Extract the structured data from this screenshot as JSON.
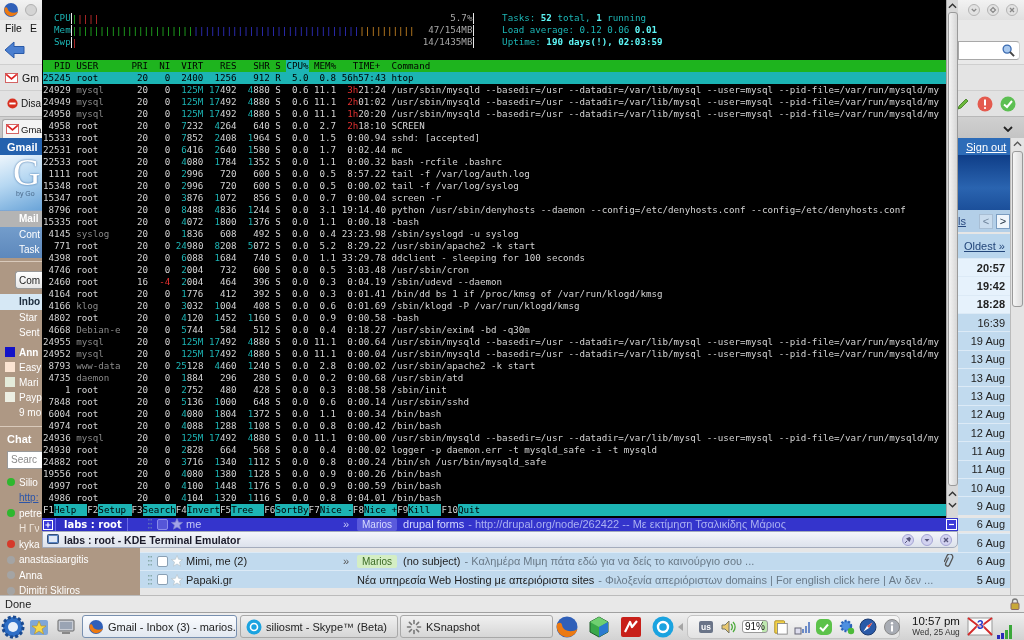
{
  "browser": {
    "menu": [
      "File",
      "E"
    ],
    "bookmarks": [
      "Gm"
    ],
    "devtools": [
      "Disa"
    ],
    "tabs": [
      {
        "label": "Gma",
        "selected": true
      }
    ],
    "status": "Done"
  },
  "terminal": {
    "meters": [
      {
        "label": "CPU",
        "reading": "5.7%",
        "segments": [
          {
            "kind": "user",
            "bars": "|"
          },
          {
            "kind": "system",
            "bars": "||||"
          }
        ]
      },
      {
        "label": "Mem",
        "reading": "47/154MB",
        "segments": [
          {
            "kind": "used",
            "bars": "||||||||||||||||||||||"
          },
          {
            "kind": "buffers",
            "bars": "||||||||||||||||||||||||||||||"
          },
          {
            "kind": "cache",
            "bars": "||||||||||"
          }
        ]
      },
      {
        "label": "Swp",
        "reading": "14/1435MB",
        "segments": [
          {
            "kind": "swap",
            "bars": "|"
          }
        ]
      }
    ],
    "summary": {
      "tasks": "Tasks: **52** total, **1** running",
      "load": "Load average: 0.12 0.06 **0.01**",
      "uptime": "Uptime: **190 days(!), 02:03:59**"
    },
    "columns": [
      {
        "label": "PID",
        "kind": "pid",
        "selected": false
      },
      {
        "label": "USER",
        "kind": "user",
        "selected": false
      },
      {
        "label": "PRI",
        "kind": "priority",
        "selected": false
      },
      {
        "label": "NI",
        "kind": "nice",
        "selected": false
      },
      {
        "label": "VIRT",
        "kind": "memory",
        "selected": false
      },
      {
        "label": "RES",
        "kind": "memory",
        "selected": false
      },
      {
        "label": "SHR",
        "kind": "memory",
        "selected": false
      },
      {
        "label": "S",
        "kind": "state",
        "selected": false
      },
      {
        "label": "CPU%",
        "kind": "percent",
        "selected": true
      },
      {
        "label": "MEM%",
        "kind": "percent",
        "selected": false
      },
      {
        "label": "TIME+",
        "kind": "time",
        "selected": false
      },
      {
        "label": "Command",
        "kind": "command",
        "selected": false
      }
    ],
    "processes": [
      {
        "cells": [
          "25245",
          "root",
          "20",
          "0",
          "2400",
          "1256",
          "912",
          "R",
          "5.0",
          "0.8",
          "56h57:43",
          "htop"
        ],
        "other_user": false,
        "selected": true
      },
      {
        "cells": [
          "24929",
          "mysql",
          "20",
          "0",
          "125M",
          "17492",
          "4880",
          "S",
          "0.6",
          "11.1",
          "3h21:24",
          "/usr/sbin/mysqld --basedir=/usr --datadir=/var/lib/mysql --user=mysql --pid-file=/var/run/mysqld/my"
        ],
        "other_user": true,
        "selected": false
      },
      {
        "cells": [
          "24949",
          "mysql",
          "20",
          "0",
          "125M",
          "17492",
          "4880",
          "S",
          "0.6",
          "11.1",
          "2h01:02",
          "/usr/sbin/mysqld --basedir=/usr --datadir=/var/lib/mysql --user=mysql --pid-file=/var/run/mysqld/my"
        ],
        "other_user": true,
        "selected": false
      },
      {
        "cells": [
          "24950",
          "mysql",
          "20",
          "0",
          "125M",
          "17492",
          "4880",
          "S",
          "0.0",
          "11.1",
          "1h20:20",
          "/usr/sbin/mysqld --basedir=/usr --datadir=/var/lib/mysql --user=mysql --pid-file=/var/run/mysqld/my"
        ],
        "other_user": true,
        "selected": false
      },
      {
        "cells": [
          "4958",
          "root",
          "20",
          "0",
          "7232",
          "4264",
          "640",
          "S",
          "0.0",
          "2.7",
          "2h18:10",
          "SCREEN"
        ],
        "other_user": false,
        "selected": false
      },
      {
        "cells": [
          "15333",
          "root",
          "20",
          "0",
          "7852",
          "2408",
          "1964",
          "S",
          "0.0",
          "1.5",
          "0:00.94",
          "sshd: [accepted]"
        ],
        "other_user": false,
        "selected": false
      },
      {
        "cells": [
          "22531",
          "root",
          "20",
          "0",
          "6416",
          "2640",
          "1580",
          "S",
          "0.0",
          "1.7",
          "0:02.44",
          "mc"
        ],
        "other_user": false,
        "selected": false
      },
      {
        "cells": [
          "22533",
          "root",
          "20",
          "0",
          "4080",
          "1784",
          "1352",
          "S",
          "0.0",
          "1.1",
          "0:00.32",
          "bash -rcfile .bashrc"
        ],
        "other_user": false,
        "selected": false
      },
      {
        "cells": [
          "1111",
          "root",
          "20",
          "0",
          "2996",
          "720",
          "600",
          "S",
          "0.0",
          "0.5",
          "8:57.22",
          "tail -f /var/log/auth.log"
        ],
        "other_user": false,
        "selected": false
      },
      {
        "cells": [
          "15348",
          "root",
          "20",
          "0",
          "2996",
          "720",
          "600",
          "S",
          "0.0",
          "0.5",
          "0:00.02",
          "tail -f /var/log/syslog"
        ],
        "other_user": false,
        "selected": false
      },
      {
        "cells": [
          "15347",
          "root",
          "20",
          "0",
          "3876",
          "1072",
          "856",
          "S",
          "0.0",
          "0.7",
          "0:00.04",
          "screen -r"
        ],
        "other_user": false,
        "selected": false
      },
      {
        "cells": [
          "8796",
          "root",
          "20",
          "0",
          "8488",
          "4836",
          "1244",
          "S",
          "0.0",
          "3.1",
          "19:14.40",
          "python /usr/sbin/denyhosts --daemon --config=/etc/denyhosts.conf --config=/etc/denyhosts.conf"
        ],
        "other_user": false,
        "selected": false
      },
      {
        "cells": [
          "15335",
          "root",
          "20",
          "0",
          "4072",
          "1800",
          "1376",
          "S",
          "0.0",
          "1.1",
          "0:00.18",
          "-bash"
        ],
        "other_user": false,
        "selected": false
      },
      {
        "cells": [
          "4145",
          "syslog",
          "20",
          "0",
          "1836",
          "608",
          "492",
          "S",
          "0.0",
          "0.4",
          "23:23.98",
          "/sbin/syslogd -u syslog"
        ],
        "other_user": true,
        "selected": false
      },
      {
        "cells": [
          "771",
          "root",
          "20",
          "0",
          "24980",
          "8208",
          "5072",
          "S",
          "0.0",
          "5.2",
          "8:29.22",
          "/usr/sbin/apache2 -k start"
        ],
        "other_user": false,
        "selected": false
      },
      {
        "cells": [
          "4398",
          "root",
          "20",
          "0",
          "6088",
          "1684",
          "740",
          "S",
          "0.0",
          "1.1",
          "33:29.78",
          "ddclient - sleeping for 100 seconds"
        ],
        "other_user": false,
        "selected": false
      },
      {
        "cells": [
          "4746",
          "root",
          "20",
          "0",
          "2004",
          "732",
          "600",
          "S",
          "0.0",
          "0.5",
          "3:03.48",
          "/usr/sbin/cron"
        ],
        "other_user": false,
        "selected": false
      },
      {
        "cells": [
          "2460",
          "root",
          "16",
          "-4",
          "2004",
          "464",
          "396",
          "S",
          "0.0",
          "0.3",
          "0:04.19",
          "/sbin/udevd --daemon"
        ],
        "other_user": false,
        "selected": false
      },
      {
        "cells": [
          "4164",
          "root",
          "20",
          "0",
          "1776",
          "412",
          "392",
          "S",
          "0.0",
          "0.3",
          "0:01.41",
          "/bin/dd bs 1 if /proc/kmsg of /var/run/klogd/kmsg"
        ],
        "other_user": false,
        "selected": false
      },
      {
        "cells": [
          "4166",
          "klog",
          "20",
          "0",
          "3032",
          "1004",
          "408",
          "S",
          "0.0",
          "0.6",
          "0:01.69",
          "/sbin/klogd -P /var/run/klogd/kmsg"
        ],
        "other_user": true,
        "selected": false
      },
      {
        "cells": [
          "4802",
          "root",
          "20",
          "0",
          "4120",
          "1452",
          "1160",
          "S",
          "0.0",
          "0.9",
          "0:00.58",
          "-bash"
        ],
        "other_user": false,
        "selected": false
      },
      {
        "cells": [
          "4668",
          "Debian-e",
          "20",
          "0",
          "5744",
          "584",
          "512",
          "S",
          "0.0",
          "0.4",
          "0:18.27",
          "/usr/sbin/exim4 -bd -q30m"
        ],
        "other_user": true,
        "selected": false
      },
      {
        "cells": [
          "24955",
          "mysql",
          "20",
          "0",
          "125M",
          "17492",
          "4880",
          "S",
          "0.0",
          "11.1",
          "0:00.64",
          "/usr/sbin/mysqld --basedir=/usr --datadir=/var/lib/mysql --user=mysql --pid-file=/var/run/mysqld/my"
        ],
        "other_user": true,
        "selected": false
      },
      {
        "cells": [
          "24952",
          "mysql",
          "20",
          "0",
          "125M",
          "17492",
          "4880",
          "S",
          "0.0",
          "11.1",
          "0:00.04",
          "/usr/sbin/mysqld --basedir=/usr --datadir=/var/lib/mysql --user=mysql --pid-file=/var/run/mysqld/my"
        ],
        "other_user": true,
        "selected": false
      },
      {
        "cells": [
          "8793",
          "www-data",
          "20",
          "0",
          "25128",
          "4460",
          "1240",
          "S",
          "0.0",
          "2.8",
          "0:00.02",
          "/usr/sbin/apache2 -k start"
        ],
        "other_user": true,
        "selected": false
      },
      {
        "cells": [
          "4735",
          "daemon",
          "20",
          "0",
          "1884",
          "296",
          "280",
          "S",
          "0.0",
          "0.2",
          "0:00.68",
          "/usr/sbin/atd"
        ],
        "other_user": true,
        "selected": false
      },
      {
        "cells": [
          "1",
          "root",
          "20",
          "0",
          "2752",
          "480",
          "428",
          "S",
          "0.0",
          "0.3",
          "8:08.58",
          "/sbin/init"
        ],
        "other_user": false,
        "selected": false
      },
      {
        "cells": [
          "7848",
          "root",
          "20",
          "0",
          "5136",
          "1000",
          "648",
          "S",
          "0.0",
          "0.6",
          "0:00.14",
          "/usr/sbin/sshd"
        ],
        "other_user": false,
        "selected": false
      },
      {
        "cells": [
          "6004",
          "root",
          "20",
          "0",
          "4080",
          "1804",
          "1372",
          "S",
          "0.0",
          "1.1",
          "0:00.34",
          "/bin/bash"
        ],
        "other_user": false,
        "selected": false
      },
      {
        "cells": [
          "4974",
          "root",
          "20",
          "0",
          "4088",
          "1288",
          "1108",
          "S",
          "0.0",
          "0.8",
          "0:00.42",
          "/bin/bash"
        ],
        "other_user": false,
        "selected": false
      },
      {
        "cells": [
          "24936",
          "mysql",
          "20",
          "0",
          "125M",
          "17492",
          "4880",
          "S",
          "0.0",
          "11.1",
          "0:00.00",
          "/usr/sbin/mysqld --basedir=/usr --datadir=/var/lib/mysql --user=mysql --pid-file=/var/run/mysqld/my"
        ],
        "other_user": true,
        "selected": false
      },
      {
        "cells": [
          "24930",
          "root",
          "20",
          "0",
          "2828",
          "664",
          "568",
          "S",
          "0.0",
          "0.4",
          "0:00.02",
          "logger -p daemon.err -t mysqld_safe -i -t mysqld"
        ],
        "other_user": false,
        "selected": false
      },
      {
        "cells": [
          "24882",
          "root",
          "20",
          "0",
          "3716",
          "1340",
          "1112",
          "S",
          "0.0",
          "0.8",
          "0:00.24",
          "/bin/sh /usr/bin/mysqld_safe"
        ],
        "other_user": false,
        "selected": false
      },
      {
        "cells": [
          "19556",
          "root",
          "20",
          "0",
          "4080",
          "1380",
          "1128",
          "S",
          "0.0",
          "0.9",
          "0:00.26",
          "/bin/bash"
        ],
        "other_user": false,
        "selected": false
      },
      {
        "cells": [
          "4997",
          "root",
          "20",
          "0",
          "4100",
          "1448",
          "1176",
          "S",
          "0.0",
          "0.9",
          "0:00.59",
          "/bin/bash"
        ],
        "other_user": false,
        "selected": false
      },
      {
        "cells": [
          "4986",
          "root",
          "20",
          "0",
          "4104",
          "1320",
          "1116",
          "S",
          "0.0",
          "0.8",
          "0:04.01",
          "/bin/bash"
        ],
        "other_user": false,
        "selected": false
      }
    ],
    "function_keys": [
      {
        "key": "F1",
        "label": "Help"
      },
      {
        "key": "F2",
        "label": "Setup"
      },
      {
        "key": "F3",
        "label": "Search"
      },
      {
        "key": "F4",
        "label": "Invert"
      },
      {
        "key": "F5",
        "label": "Tree"
      },
      {
        "key": "F6",
        "label": "SortBy"
      },
      {
        "key": "F7",
        "label": "Nice -"
      },
      {
        "key": "F8",
        "label": "Nice +"
      },
      {
        "key": "F9",
        "label": "Kill"
      },
      {
        "key": "F10",
        "label": "Quit"
      }
    ],
    "tab": {
      "label": "labs : root",
      "selected": true
    },
    "title": "labs : root - KDE Terminal Emulator"
  },
  "gmail": {
    "title": "Gmail",
    "logo": {
      "letter": "G",
      "byline": "by Go"
    },
    "sign_out": "Sign out",
    "nav": [
      {
        "label": "Mail",
        "selected": true
      },
      {
        "label": "Cont",
        "selected": false
      },
      {
        "label": "Task",
        "selected": false
      }
    ],
    "compose": "Com",
    "folders": [
      {
        "label": "Inbo",
        "selected": true
      },
      {
        "label": "Star",
        "selected": false
      },
      {
        "label": "Sent",
        "selected": false
      }
    ],
    "labels": [
      {
        "label": "Ann",
        "color": "#1212c8",
        "unread": true
      },
      {
        "label": "Easy",
        "color": "#fbe4d2",
        "unread": false
      },
      {
        "label": "Mari",
        "color": "#e4ebda",
        "unread": false
      },
      {
        "label": "Payp",
        "color": "#eceee2",
        "unread": false
      }
    ],
    "more_labels": "9 mo",
    "chat": {
      "title": "Chat",
      "search_placeholder": "Searc",
      "contacts": [
        {
          "name": "Silio",
          "color": "#2eb82e",
          "status": {
            "text": "http:",
            "kind": "link"
          }
        },
        {
          "name": "petre",
          "color": "#2eb82e",
          "status": {
            "text": "Η Γν",
            "kind": "message"
          }
        },
        {
          "name": "kyka",
          "color": "#d63a2a"
        },
        {
          "name": "anastasiaargitis",
          "color": "#a4a4a4"
        },
        {
          "name": "Anna",
          "color": "#a4a4a4"
        },
        {
          "name": "Dimitri Skliros",
          "color": "#a4a4a4"
        }
      ]
    },
    "pager": {
      "link": "ls",
      "buttons": [
        {
          "label": "<",
          "disabled": true
        },
        {
          "label": ">",
          "disabled": false
        }
      ],
      "oldest": "Oldest »"
    },
    "rows": [
      {
        "date": "20:57",
        "unread": true
      },
      {
        "date": "19:42",
        "unread": true
      },
      {
        "date": "18:28",
        "unread": true
      },
      {
        "date": "16:39",
        "unread": false
      },
      {
        "date": "19 Aug",
        "unread": false
      },
      {
        "date": "13 Aug",
        "unread": false
      },
      {
        "date": "13 Aug",
        "unread": false
      },
      {
        "date": "13 Aug",
        "unread": false
      },
      {
        "date": "12 Aug",
        "unread": false
      },
      {
        "date": "12 Aug",
        "unread": false
      },
      {
        "date": "11 Aug",
        "unread": false
      },
      {
        "date": "11 Aug",
        "unread": false
      },
      {
        "date": "10 Aug",
        "unread": false
      },
      {
        "date": "9 Aug",
        "unread": false
      },
      {
        "sender": "me",
        "marker": "»",
        "label": "Marios",
        "subject": "drupal forms",
        "snippet": "- http://drupal.org/node/262422 -- Με εκτίμηση Τσαλικίδης Μάριος",
        "attachment": false,
        "checked": false,
        "starred": false,
        "date": "6 Aug",
        "unread": false
      },
      {
        "date": "6 Aug",
        "unread": false
      },
      {
        "sender": "Mimi, me (2)",
        "marker": "»",
        "label": "Marios",
        "subject": "(no subject)",
        "snippet": "- Καλημέρα Μιμη πάτα εδώ για να δείς το καινούργιο σου ...",
        "attachment": true,
        "checked": false,
        "starred": false,
        "date": "6 Aug",
        "unread": false
      },
      {
        "sender": "Papaki.gr",
        "subject": "Νέα υπηρεσία Web Hosting με απεριόριστα sites",
        "snippet": "- Φιλοξενία απεριόριστων domains | For english click here | Αν δεν ...",
        "attachment": false,
        "checked": false,
        "starred": false,
        "date": "5 Aug",
        "unread": false
      }
    ]
  },
  "taskbar": {
    "tasks": [
      {
        "label": "Gmail - Inbox (3) - marios.",
        "kind": "browser",
        "selected": true
      },
      {
        "label": "siliosmt - Skype™ (Beta)",
        "kind": "messenger",
        "selected": false
      },
      {
        "label": "KSnapshot",
        "kind": "screenshot",
        "selected": false
      }
    ],
    "keyboard_layout": "us",
    "battery": "91%",
    "clock": {
      "time": "10:57 pm",
      "date": "Wed, 25 Aug"
    },
    "mail_count": "3"
  }
}
